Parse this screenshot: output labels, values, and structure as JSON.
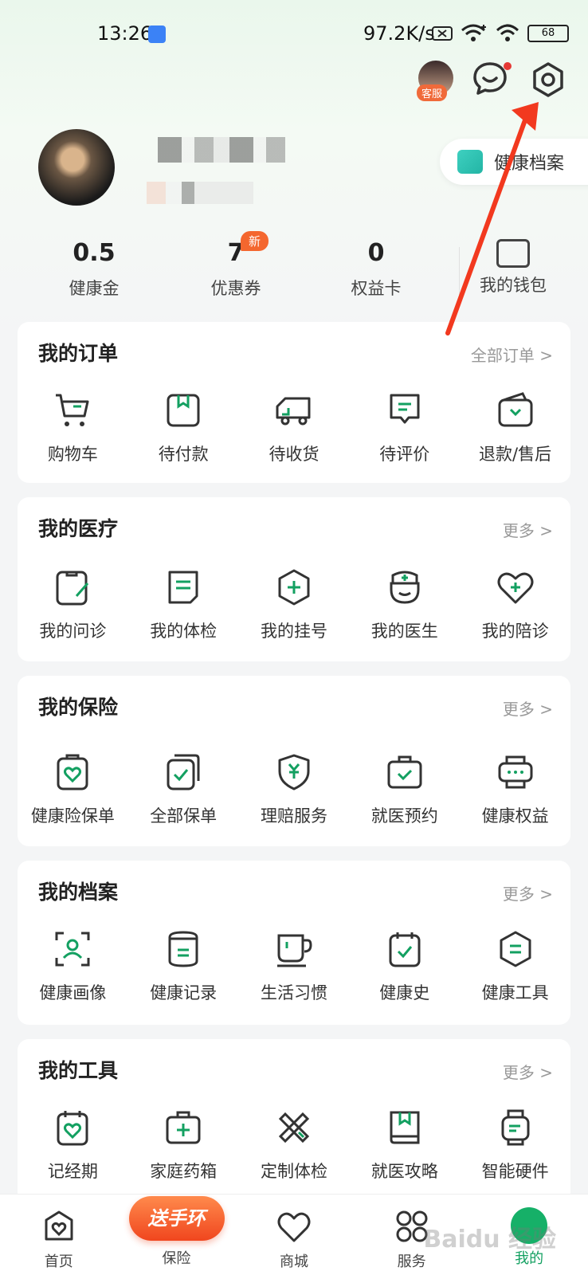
{
  "status_bar": {
    "time": "13:26",
    "net_speed": "97.2K/s",
    "battery": "68"
  },
  "header": {
    "customer_service_label": "客服"
  },
  "profile": {
    "health_file_label": "健康档案"
  },
  "stats": [
    {
      "value": "0.5",
      "label": "健康金"
    },
    {
      "value": "7",
      "label": "优惠券",
      "badge": "新"
    },
    {
      "value": "0",
      "label": "权益卡"
    },
    {
      "label": "我的钱包"
    }
  ],
  "orders": {
    "title": "我的订单",
    "more": "全部订单 >",
    "items": [
      {
        "label": "购物车",
        "icon": "cart-icon"
      },
      {
        "label": "待付款",
        "icon": "wallet-icon"
      },
      {
        "label": "待收货",
        "icon": "truck-icon"
      },
      {
        "label": "待评价",
        "icon": "comment-icon"
      },
      {
        "label": "退款/售后",
        "icon": "refund-icon"
      }
    ]
  },
  "medical": {
    "title": "我的医疗",
    "more": "更多 >",
    "items": [
      {
        "label": "我的问诊",
        "icon": "consult-icon"
      },
      {
        "label": "我的体检",
        "icon": "checkup-icon"
      },
      {
        "label": "我的挂号",
        "icon": "register-icon"
      },
      {
        "label": "我的医生",
        "icon": "doctor-icon"
      },
      {
        "label": "我的陪诊",
        "icon": "escort-icon"
      }
    ]
  },
  "insurance": {
    "title": "我的保险",
    "more": "更多 >",
    "items": [
      {
        "label": "健康险保单",
        "icon": "policy-icon"
      },
      {
        "label": "全部保单",
        "icon": "all-policies-icon"
      },
      {
        "label": "理赔服务",
        "icon": "claim-icon"
      },
      {
        "label": "就医预约",
        "icon": "appointment-icon"
      },
      {
        "label": "健康权益",
        "icon": "benefit-icon"
      }
    ]
  },
  "records": {
    "title": "我的档案",
    "more": "更多 >",
    "items": [
      {
        "label": "健康画像",
        "icon": "portrait-icon"
      },
      {
        "label": "健康记录",
        "icon": "record-icon"
      },
      {
        "label": "生活习惯",
        "icon": "habit-icon"
      },
      {
        "label": "健康史",
        "icon": "history-icon"
      },
      {
        "label": "健康工具",
        "icon": "tool-icon"
      }
    ]
  },
  "tools": {
    "title": "我的工具",
    "more": "更多 >",
    "items": [
      {
        "label": "记经期",
        "icon": "period-icon"
      },
      {
        "label": "家庭药箱",
        "icon": "medicine-box-icon"
      },
      {
        "label": "定制体检",
        "icon": "custom-checkup-icon"
      },
      {
        "label": "就医攻略",
        "icon": "guide-icon"
      },
      {
        "label": "智能硬件",
        "icon": "device-icon"
      }
    ]
  },
  "tabbar": {
    "promo": "送手环",
    "tabs": [
      {
        "label": "首页"
      },
      {
        "label": "保险"
      },
      {
        "label": "商城"
      },
      {
        "label": "服务"
      },
      {
        "label": "我的"
      }
    ]
  },
  "watermark": "Baidu 经验",
  "colors": {
    "accent": "#13a061",
    "promo": "#f0461e",
    "arrow": "#f2391f"
  }
}
